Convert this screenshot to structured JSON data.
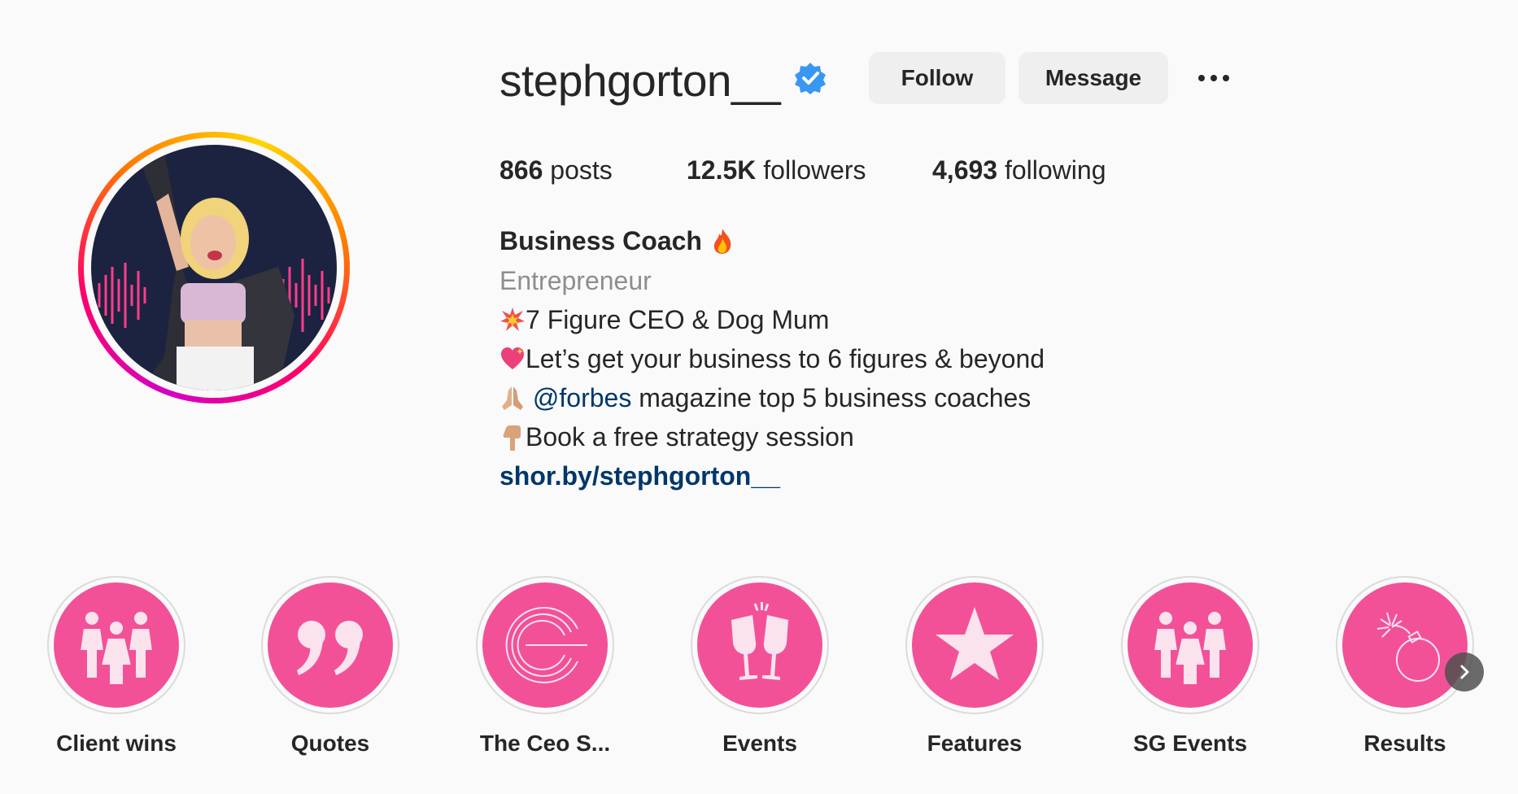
{
  "profile": {
    "username": "stephgorton__",
    "verified": true
  },
  "actions": {
    "follow_label": "Follow",
    "message_label": "Message",
    "more_icon": "more-horizontal-icon"
  },
  "stats": {
    "posts_count": "866",
    "posts_label": " posts",
    "followers_count": "12.5K",
    "followers_label": " followers",
    "following_count": "4,693",
    "following_label": " following"
  },
  "bio": {
    "name": "Business Coach ",
    "category": "Entrepreneur",
    "line1_text": "7 Figure CEO & Dog Mum",
    "line2_text": "Let’s get your business to 6 figures & beyond",
    "line3_mention": "@forbes",
    "line3_text": " magazine top 5 business coaches",
    "line4_text": "Book a free strategy session",
    "link": "shor.by/stephgorton__"
  },
  "highlights": [
    {
      "label": "Client wins",
      "icon": "group-people-icon"
    },
    {
      "label": "Quotes",
      "icon": "quote-marks-icon"
    },
    {
      "label": "The Ceo S...",
      "icon": "ceo-logo-icon"
    },
    {
      "label": "Events",
      "icon": "champagne-toast-icon"
    },
    {
      "label": "Features",
      "icon": "star-icon"
    },
    {
      "label": "SG Events",
      "icon": "group-people-icon"
    },
    {
      "label": "Results",
      "icon": "bomb-icon"
    }
  ],
  "colors": {
    "highlight_pink": "#f25198",
    "link_blue": "#00376b",
    "verified_blue": "#3897f0",
    "button_bg": "#efefef"
  }
}
